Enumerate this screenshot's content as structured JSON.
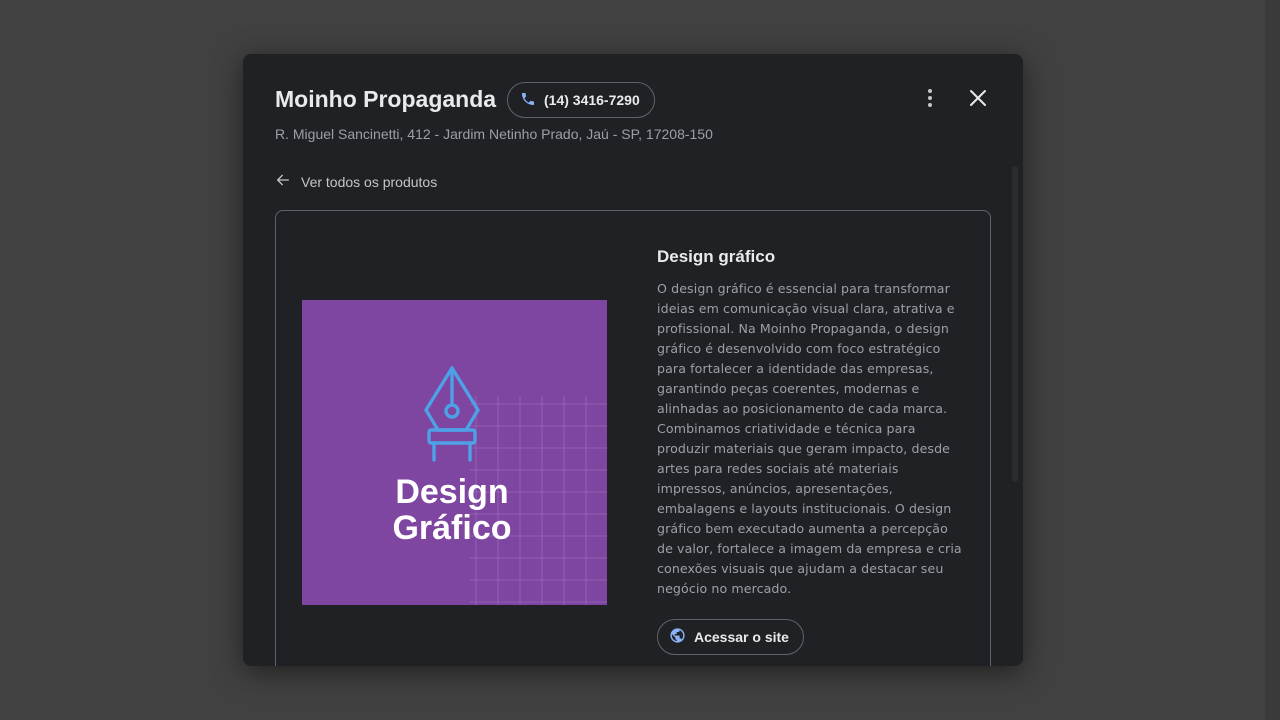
{
  "business": {
    "name": "Moinho Propaganda",
    "phone": "(14) 3416-7290",
    "address": "R. Miguel Sancinetti, 412 - Jardim Netinho Prado, Jaú - SP, 17208-150"
  },
  "header": {
    "more_icon": "more-vert-icon",
    "close_icon": "close-icon"
  },
  "nav": {
    "back_label": "Ver todos os produtos",
    "back_icon": "arrow-back-icon"
  },
  "product": {
    "title": "Design gráfico",
    "image": {
      "text_line1": "Design",
      "text_line2": "Gráfico",
      "background_color": "#7e45a1",
      "icon_color": "#4ea1e6",
      "icon": "pen-nib-icon"
    },
    "description": "O design gráfico é essencial para transformar ideias em comunicação visual clara, atrativa e profissional. Na Moinho Propaganda, o design gráfico é desenvolvido com foco estratégico para fortalecer a identidade das empresas, garantindo peças coerentes, modernas e alinhadas ao posicionamento de cada marca. Combinamos criatividade e técnica para produzir materiais que geram impacto, desde artes para redes sociais até materiais impressos, anúncios, apresentações, embalagens e layouts institucionais. O design gráfico bem executado aumenta a percepção de valor, fortalece a imagem da empresa e cria conexões visuais que ajudam a destacar seu negócio no mercado.",
    "website_button": "Acessar o site"
  },
  "colors": {
    "accent": "#8ab4f8",
    "modal_bg": "#202124",
    "overlay_bg": "#414141"
  }
}
